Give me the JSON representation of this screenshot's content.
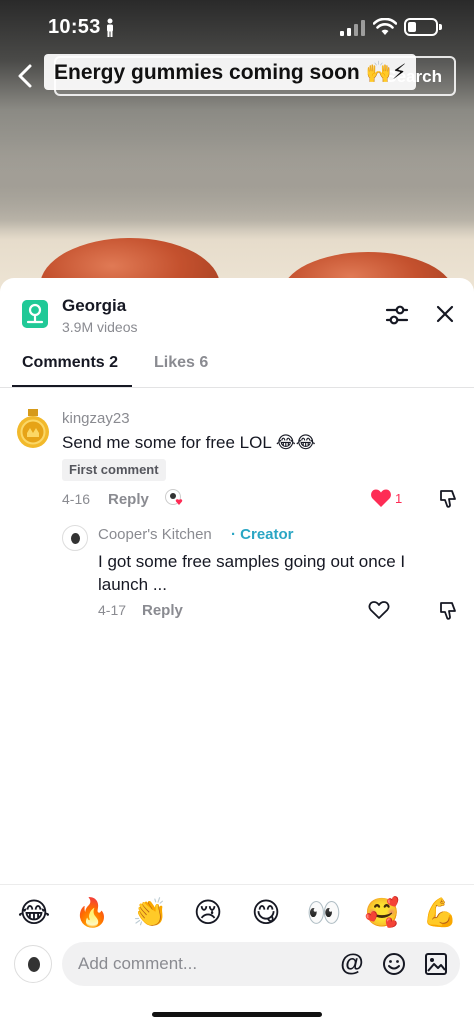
{
  "status": {
    "time": "10:53"
  },
  "video": {
    "search_label": "Search",
    "title": "Energy gummies coming soon 🙌⚡"
  },
  "topic": {
    "name": "Georgia",
    "count": "3.9M videos"
  },
  "tabs": [
    {
      "label": "Comments 2",
      "active": true
    },
    {
      "label": "Likes 6",
      "active": false
    }
  ],
  "comments": [
    {
      "user": "kingzay23",
      "text": "Send me some for free LOL 😂😂",
      "badge": "First comment",
      "date": "4-16",
      "reply_label": "Reply",
      "likes": "1",
      "liked": true,
      "replies": [
        {
          "user": "Cooper's Kitchen",
          "role": "· Creator",
          "text": "I got some free samples going out once I launch ...",
          "date": "4-17",
          "reply_label": "Reply"
        }
      ]
    }
  ],
  "emoji_bar": [
    "😂",
    "🔥",
    "👏",
    "😢",
    "😋",
    "👀",
    "🥰",
    "💪"
  ],
  "composer": {
    "placeholder": "Add comment...",
    "mention_symbol": "@"
  },
  "colors": {
    "accent": "#fe2c55",
    "creator": "#2aa6c4",
    "topic": "#20c997"
  }
}
